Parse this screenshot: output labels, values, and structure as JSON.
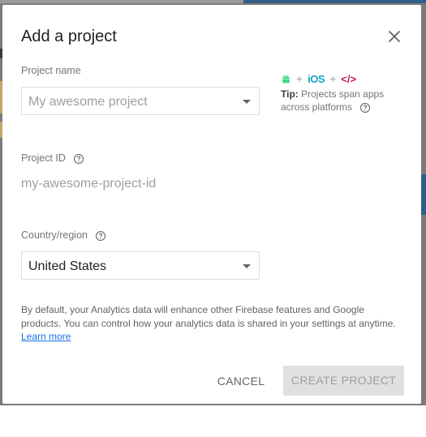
{
  "dialog": {
    "title": "Add a project",
    "close_icon": "close-icon"
  },
  "project_name": {
    "label": "Project name",
    "placeholder": "My awesome project"
  },
  "tip": {
    "logos": [
      "android-icon",
      "+",
      "iOS",
      "+",
      "</>"
    ],
    "ios_text": "iOS",
    "web_text": "</>",
    "plus": "+",
    "bold": "Tip:",
    "text": " Projects span apps across platforms"
  },
  "project_id": {
    "label": "Project ID",
    "value": "my-awesome-project-id"
  },
  "country": {
    "label": "Country/region",
    "selected": "United States"
  },
  "disclaimer": {
    "text": "By default, your Analytics data will enhance other Firebase features and Google products. You can control how your analytics data is shared in your settings at anytime.",
    "link": "Learn more"
  },
  "buttons": {
    "cancel": "CANCEL",
    "create": "CREATE PROJECT"
  },
  "colors": {
    "accent": "#1a73e8",
    "ios": "#12a5c7",
    "web": "#c2185b",
    "android": "#3ddc84",
    "disabled_bg": "#e0e0e0"
  }
}
